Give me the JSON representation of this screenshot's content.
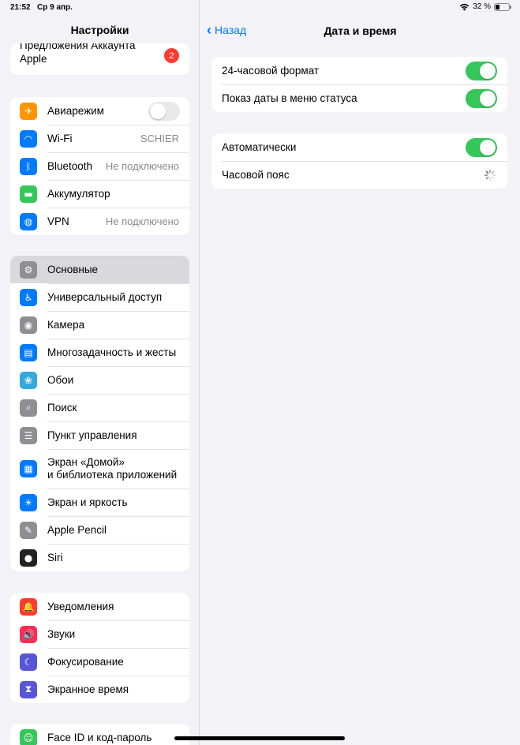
{
  "statusbar": {
    "time": "21:52",
    "date": "Ср 9 апр.",
    "battery_pct": "32 %",
    "battery_level": 0.32
  },
  "sidebar": {
    "title": "Настройки",
    "account": {
      "label_line1": "Предложения Аккаунта",
      "label_line2": "Apple",
      "badge": "2"
    },
    "group1": [
      {
        "label": "Авиарежим",
        "icon": "airplane-icon",
        "color": "#ff9500",
        "toggle": "off"
      },
      {
        "label": "Wi-Fi",
        "icon": "wifi-icon",
        "color": "#007aff",
        "value": "SCHIER"
      },
      {
        "label": "Bluetooth",
        "icon": "bluetooth-icon",
        "color": "#007aff",
        "value": "Не подключено"
      },
      {
        "label": "Аккумулятор",
        "icon": "battery-icon",
        "color": "#34c759"
      },
      {
        "label": "VPN",
        "icon": "globe-icon",
        "color": "#007aff",
        "value": "Не подключено"
      }
    ],
    "group2": [
      {
        "label": "Основные",
        "icon": "gear-icon",
        "color": "#8e8e93",
        "selected": true
      },
      {
        "label": "Универсальный доступ",
        "icon": "accessibility-icon",
        "color": "#007aff"
      },
      {
        "label": "Камера",
        "icon": "camera-icon",
        "color": "#8e8e93"
      },
      {
        "label": "Многозадачность и жесты",
        "icon": "multitasking-icon",
        "color": "#007aff"
      },
      {
        "label": "Обои",
        "icon": "wallpaper-icon",
        "color": "#34aadc"
      },
      {
        "label": "Поиск",
        "icon": "search-icon",
        "color": "#8e8e93"
      },
      {
        "label": "Пункт управления",
        "icon": "control-center-icon",
        "color": "#8e8e93"
      },
      {
        "label": "Экран «Домой»",
        "label2": "и библиотека приложений",
        "icon": "home-screen-icon",
        "color": "#007aff"
      },
      {
        "label": "Экран и яркость",
        "icon": "brightness-icon",
        "color": "#007aff"
      },
      {
        "label": "Apple Pencil",
        "icon": "pencil-icon",
        "color": "#8e8e93"
      },
      {
        "label": "Siri",
        "icon": "siri-icon",
        "color": "#222"
      }
    ],
    "group3": [
      {
        "label": "Уведомления",
        "icon": "bell-icon",
        "color": "#ff3b30"
      },
      {
        "label": "Звуки",
        "icon": "speaker-icon",
        "color": "#ff2d55"
      },
      {
        "label": "Фокусирование",
        "icon": "moon-icon",
        "color": "#5856d6"
      },
      {
        "label": "Экранное время",
        "icon": "hourglass-icon",
        "color": "#5856d6"
      }
    ],
    "group4": [
      {
        "label": "Face ID и код-пароль",
        "icon": "faceid-icon",
        "color": "#34c759"
      }
    ]
  },
  "detail": {
    "back_label": "Назад",
    "title": "Дата и время",
    "section1": [
      {
        "label": "24-часовой формат",
        "toggle": "on"
      },
      {
        "label": "Показ даты в меню статуса",
        "toggle": "on"
      }
    ],
    "section2": [
      {
        "label": "Автоматически",
        "toggle": "on"
      },
      {
        "label": "Часовой пояс"
      }
    ]
  }
}
